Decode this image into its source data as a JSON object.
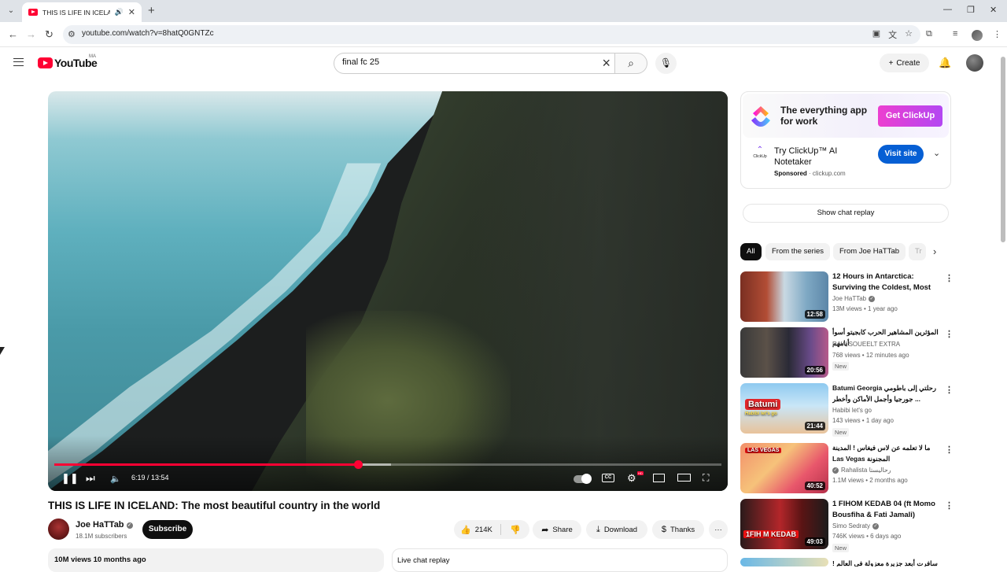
{
  "browser": {
    "tab_title": "THIS IS LIFE IN ICELAND: Th",
    "url": "youtube.com/watch?v=8hatQ0GNTZc"
  },
  "header": {
    "logo_text": "YouTube",
    "country_code": "MA",
    "search_value": "final fc 25",
    "create_label": "Create"
  },
  "player": {
    "time_current": "6:19",
    "time_total": "13:54",
    "time_display": "6:19 / 13:54",
    "progress": 0.455,
    "buffered": 0.505,
    "cc_label": "CC",
    "hd_label": "HD"
  },
  "video": {
    "title": "THIS IS LIFE IN ICELAND: The most beautiful country in the world",
    "channel": "Joe HaTTab",
    "subscribers": "18.1M subscribers",
    "subscribe_label": "Subscribe",
    "likes": "214K",
    "share_label": "Share",
    "download_label": "Download",
    "thanks_label": "Thanks",
    "views_date": "10M views  10 months ago",
    "live_chat_label": "Live chat replay"
  },
  "ad": {
    "headline": "The everything app for work",
    "cta": "Get ClickUp",
    "small_logo": "ClickUp",
    "title": "Try ClickUp™ AI Notetaker",
    "sponsored": "Sponsored",
    "domain": "clickup.com",
    "visit_label": "Visit site"
  },
  "show_chat_label": "Show chat replay",
  "chips": [
    "All",
    "From the series",
    "From Joe HaTTab",
    "Tr"
  ],
  "recommendations": [
    {
      "title": "12 Hours in Antarctica: Surviving the Coldest, Most ...",
      "channel": "Joe HaTTab",
      "verified": true,
      "meta": "13M views • 1 year ago",
      "duration": "12:58",
      "new": false
    },
    {
      "title": "المؤثرين المشاهير الحرب كابجيتو أسوأ أيامهم",
      "channel": "RAW SOUEELT EXTRA",
      "verified": false,
      "meta": "768 views • 12 minutes ago",
      "duration": "20:56",
      "new": true,
      "new_label": "New"
    },
    {
      "title": "Batumi Georgia  رحلتي إلى باطومي جورجيا وأجمل الأماكن وأخطر ...",
      "channel": "Habibi let's go",
      "verified": false,
      "meta": "143 views • 1 day ago",
      "duration": "21:44",
      "new": true,
      "new_label": "New",
      "thumb_text": "Batumi",
      "thumb_sub": "Habibi let's go"
    },
    {
      "title": "ما لا تعلمه عن لاس فيغاس ! المدينة المجنونة Las Vegas",
      "channel": "Rahalista رحاليستا",
      "verified": true,
      "meta": "1.1M views • 2 months ago",
      "duration": "40:52",
      "new": false,
      "thumb_text": "LAS VEGAS"
    },
    {
      "title": "1 FIHOM KEDAB 04 (ft Momo Bousfiha & Fati Jamali)",
      "channel": "Simo Sedraty",
      "verified": true,
      "meta": "746K views • 6 days ago",
      "duration": "49:03",
      "new": true,
      "new_label": "New",
      "thumb_text": "1FIH M KEDAB"
    },
    {
      "title": "سافرت أبعد جزيرة معزولة في العالم !",
      "channel": "",
      "verified": false,
      "meta": "",
      "duration": "",
      "new": false
    }
  ]
}
